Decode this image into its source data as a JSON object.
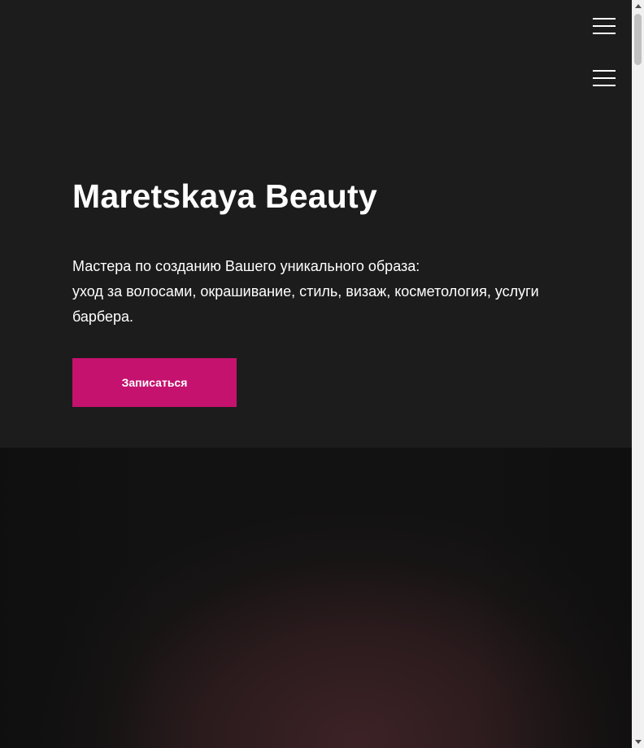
{
  "header": {
    "menu_icon": "hamburger-menu-icon",
    "menu_icon_secondary": "hamburger-menu-icon"
  },
  "hero": {
    "title": "Maretskaya Beauty",
    "description_line1": "Мастера по созданию Вашего уникального образа:",
    "description_line2": "уход за волосами, окрашивание, стиль, визаж, косметология, услуги барбера.",
    "cta_label": "Записаться"
  },
  "colors": {
    "background": "#1c1c1d",
    "accent": "#c4126e",
    "text": "#ffffff"
  }
}
